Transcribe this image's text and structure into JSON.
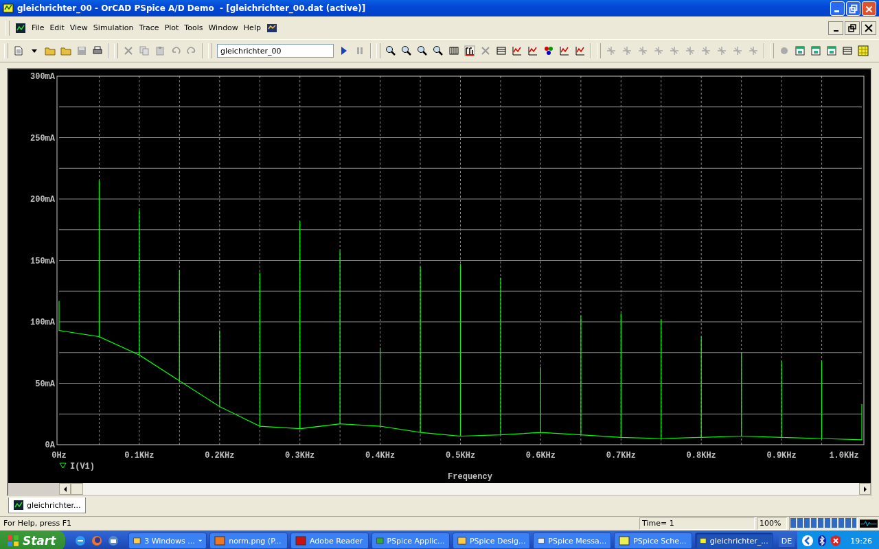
{
  "window": {
    "title": "gleichrichter_00 - OrCAD PSpice A/D Demo  - [gleichrichter_00.dat (active)]"
  },
  "menu": [
    "File",
    "Edit",
    "View",
    "Simulation",
    "Trace",
    "Plot",
    "Tools",
    "Window",
    "Help"
  ],
  "toolbar": {
    "profile_field": {
      "value": "gleichrichter_00"
    }
  },
  "plot": {
    "chart_data": {
      "type": "line",
      "xlabel": "Frequency",
      "x": [
        0,
        0,
        0.05,
        0.05,
        0.05,
        0.1,
        0.1,
        0.1,
        0.15,
        0.15,
        0.15,
        0.2,
        0.2,
        0.2,
        0.25,
        0.25,
        0.25,
        0.3,
        0.3,
        0.3,
        0.35,
        0.35,
        0.35,
        0.4,
        0.4,
        0.4,
        0.45,
        0.45,
        0.45,
        0.5,
        0.5,
        0.5,
        0.55,
        0.55,
        0.55,
        0.6,
        0.6,
        0.6,
        0.65,
        0.65,
        0.65,
        0.7,
        0.7,
        0.7,
        0.75,
        0.75,
        0.75,
        0.8,
        0.8,
        0.8,
        0.85,
        0.85,
        0.85,
        0.9,
        0.9,
        0.9,
        0.95,
        0.95,
        0.95,
        1.0,
        1.0,
        1.0
      ],
      "series": [
        {
          "name": "I(V1)",
          "color": "#00ff00",
          "values": [
            117,
            93,
            88,
            215,
            88,
            73,
            191,
            73,
            52,
            142,
            52,
            31,
            93,
            31,
            15,
            140,
            15,
            13,
            182,
            13,
            17,
            158,
            17,
            15,
            79,
            15,
            10,
            145,
            10,
            7,
            147,
            7,
            8,
            136,
            8,
            10,
            63,
            10,
            8,
            105,
            8,
            6,
            107,
            6,
            5,
            102,
            5,
            6,
            88,
            6,
            7,
            75,
            7,
            6,
            68,
            6,
            5,
            68,
            5,
            4,
            33,
            4
          ]
        }
      ],
      "xlim": [
        0,
        1
      ],
      "ylim": [
        0,
        300
      ],
      "grid": true,
      "xticks": [
        {
          "value": 0,
          "label": "0Hz"
        },
        {
          "value": 0.1,
          "label": "0.1KHz"
        },
        {
          "value": 0.2,
          "label": "0.2KHz"
        },
        {
          "value": 0.3,
          "label": "0.3KHz"
        },
        {
          "value": 0.4,
          "label": "0.4KHz"
        },
        {
          "value": 0.5,
          "label": "0.5KHz"
        },
        {
          "value": 0.6,
          "label": "0.6KHz"
        },
        {
          "value": 0.7,
          "label": "0.7KHz"
        },
        {
          "value": 0.8,
          "label": "0.8KHz"
        },
        {
          "value": 0.9,
          "label": "0.9KHz"
        },
        {
          "value": 1.0,
          "label": "1.0KHz"
        }
      ],
      "yticks": [
        {
          "value": 0,
          "label": "0A"
        },
        {
          "value": 50,
          "label": "50mA"
        },
        {
          "value": 100,
          "label": "100mA"
        },
        {
          "value": 150,
          "label": "150mA"
        },
        {
          "value": 200,
          "label": "200mA"
        },
        {
          "value": 250,
          "label": "250mA"
        },
        {
          "value": 300,
          "label": "300mA"
        }
      ]
    }
  },
  "document_tabs": [
    {
      "label": "gleichrichter...",
      "selected": true
    }
  ],
  "status_bar": {
    "help": "For Help, press F1",
    "time": "Time= 1",
    "zoom": "100%",
    "progress": {
      "level": 1
    }
  },
  "taskbar": {
    "start": "Start",
    "items": [
      {
        "label": "3 Windows ...",
        "selected": false
      },
      {
        "label": "norm.png (P...",
        "selected": false
      },
      {
        "label": "Adobe Reader",
        "selected": false
      },
      {
        "label": "PSpice Applic...",
        "selected": false
      },
      {
        "label": "PSpice Desig...",
        "selected": false
      },
      {
        "label": "PSpice Messa...",
        "selected": false
      },
      {
        "label": "PSpice Sche...",
        "selected": false
      },
      {
        "label": "gleichrichter_...",
        "selected": true
      }
    ],
    "language": "DE",
    "clock": "19:26"
  }
}
